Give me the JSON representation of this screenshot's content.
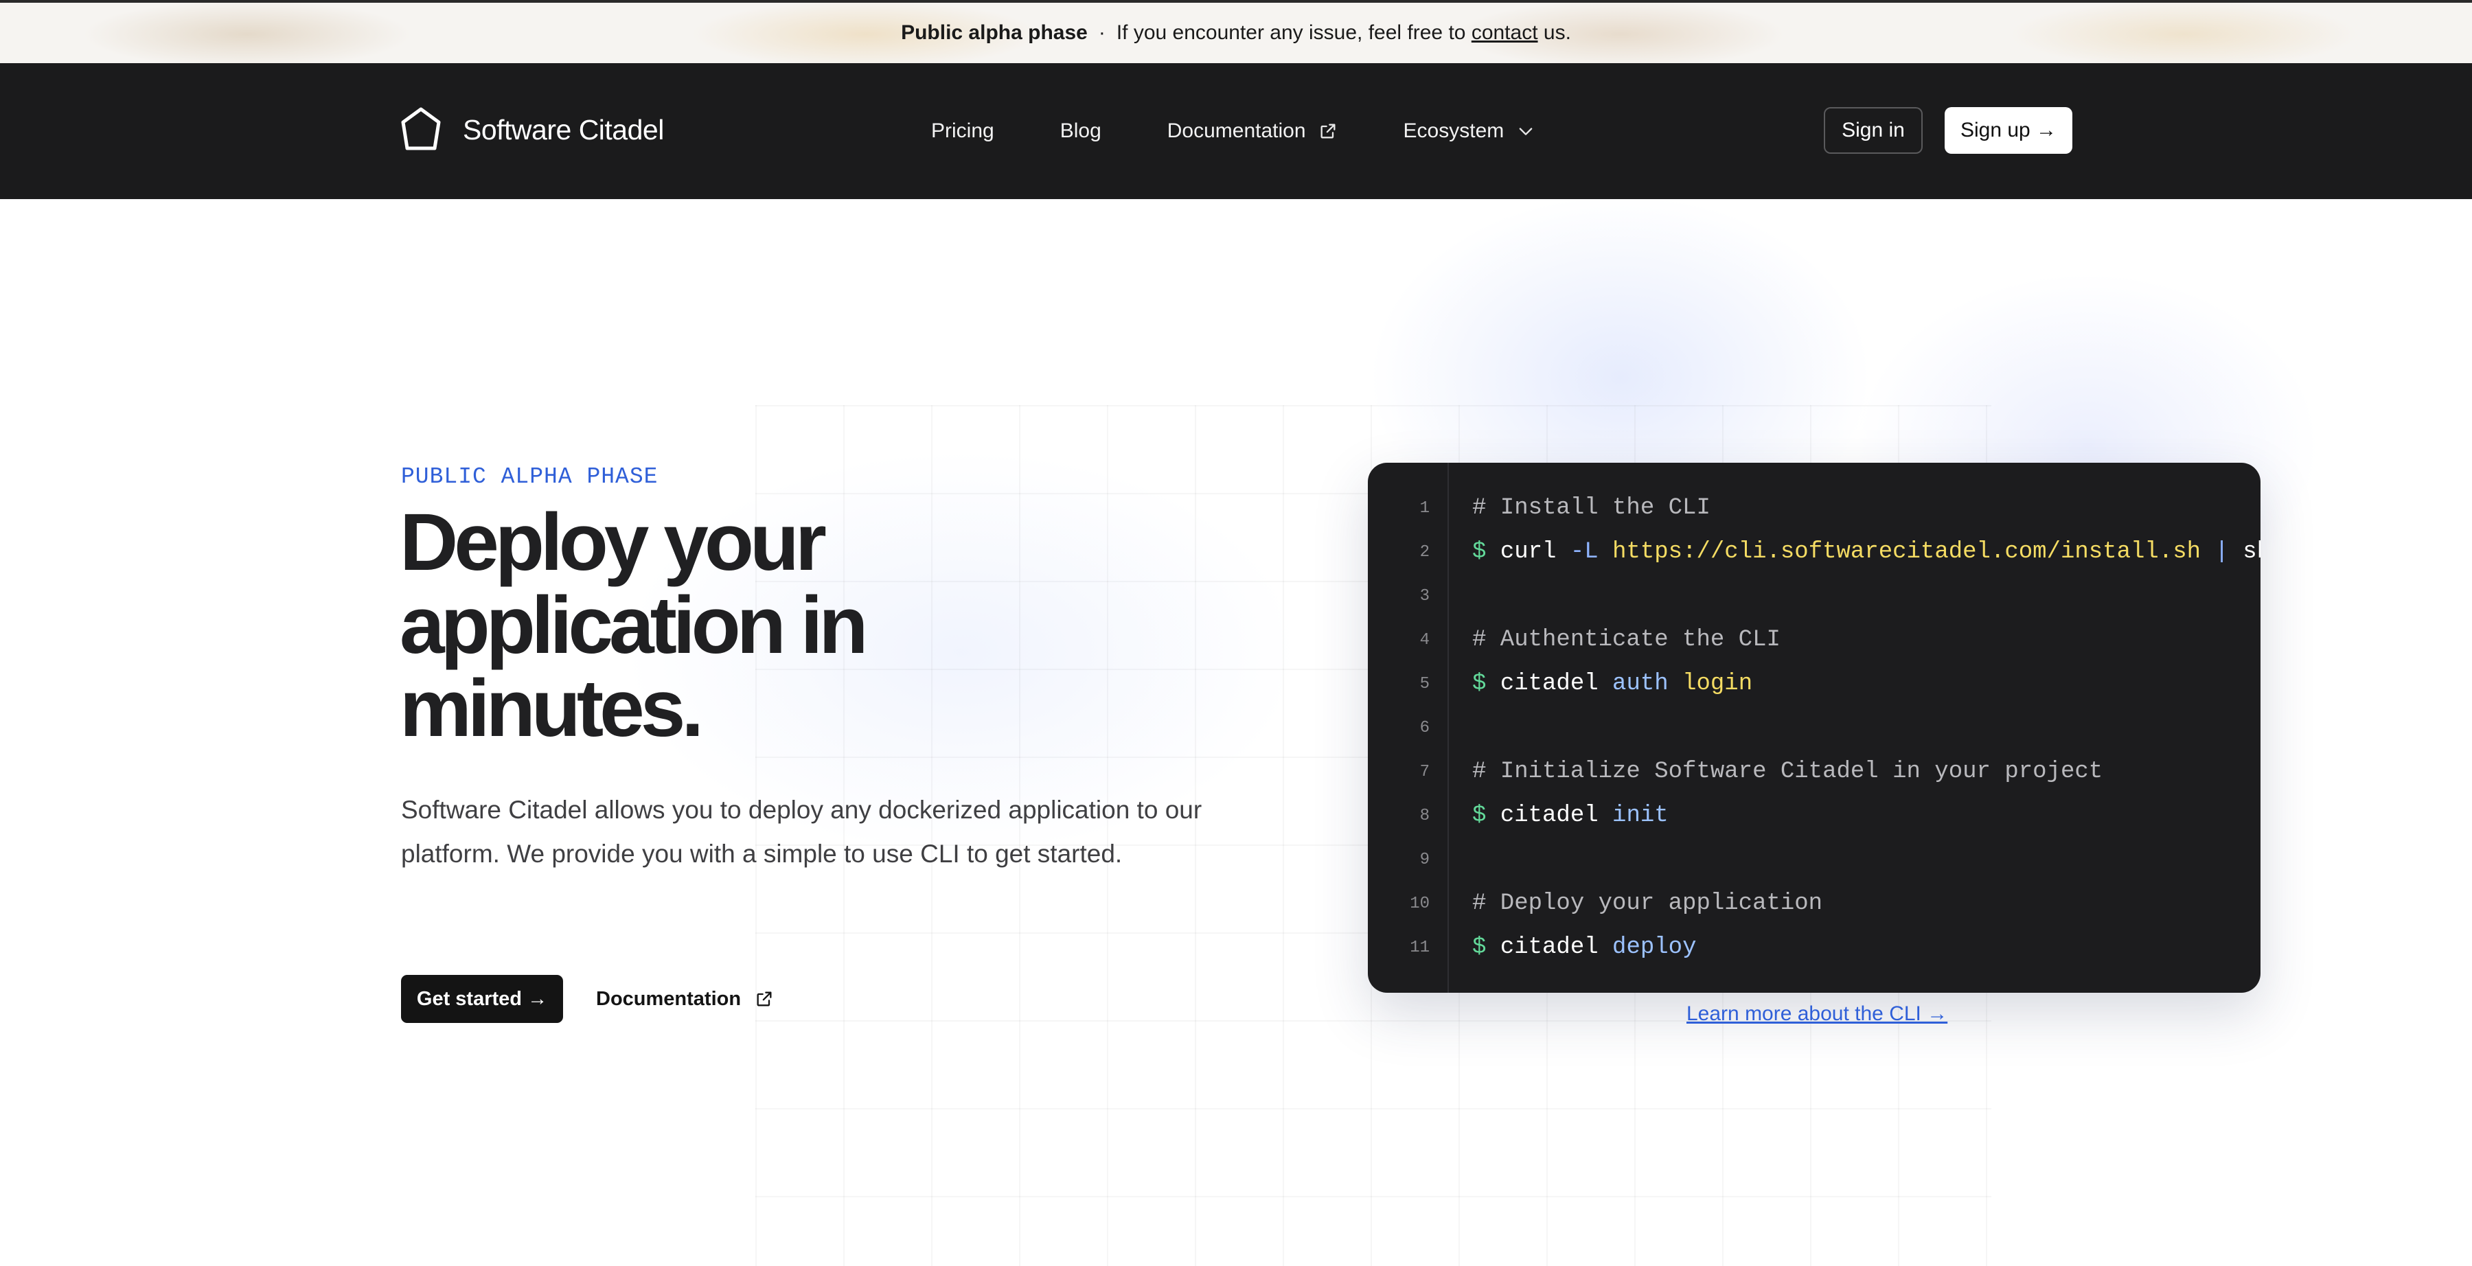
{
  "banner": {
    "title": "Public alpha phase",
    "separator": "·",
    "message_before": "If you encounter any issue, feel free to",
    "link": "contact",
    "message_after": "us."
  },
  "nav": {
    "brand": "Software Citadel",
    "links": [
      "Pricing",
      "Blog",
      "Documentation",
      "Ecosystem"
    ],
    "sign_in": "Sign in",
    "sign_up": "Sign up →"
  },
  "hero": {
    "eyebrow": "PUBLIC ALPHA PHASE",
    "headline": [
      "Deploy your",
      "application in",
      "minutes."
    ],
    "description": "Software Citadel allows you to deploy any dockerized application to our platform. We provide you with a simple to use CLI to get started.",
    "cta_primary": "Get started →",
    "cta_secondary": "Documentation"
  },
  "code_block": {
    "lines": [
      {
        "n": "1",
        "comment": "# Install the CLI"
      },
      {
        "n": "2",
        "prompt": "$",
        "cmd": "curl",
        "flag": "-L",
        "arg": "https://cli.softwarecitadel.com/install.sh",
        "pipe": "|",
        "tail": "sh"
      },
      {
        "n": "3"
      },
      {
        "n": "4",
        "comment": "# Authenticate the CLI"
      },
      {
        "n": "5",
        "prompt": "$",
        "cmd": "citadel",
        "sub": "auth",
        "arg": "login"
      },
      {
        "n": "6"
      },
      {
        "n": "7",
        "comment": "# Initialize Software Citadel in your project"
      },
      {
        "n": "8",
        "prompt": "$",
        "cmd": "citadel",
        "sub": "init"
      },
      {
        "n": "9"
      },
      {
        "n": "10",
        "comment": "# Deploy your application"
      },
      {
        "n": "11",
        "prompt": "$",
        "cmd": "citadel",
        "sub": "deploy"
      }
    ],
    "learn_more": "Learn more about the CLI →"
  },
  "colors": {
    "nav_bg": "#1b1b1c",
    "accent_blue": "#2f5fd8",
    "code_bg": "#1c1c1e",
    "prompt_green": "#63d99a",
    "string_yellow": "#f5dc63"
  }
}
